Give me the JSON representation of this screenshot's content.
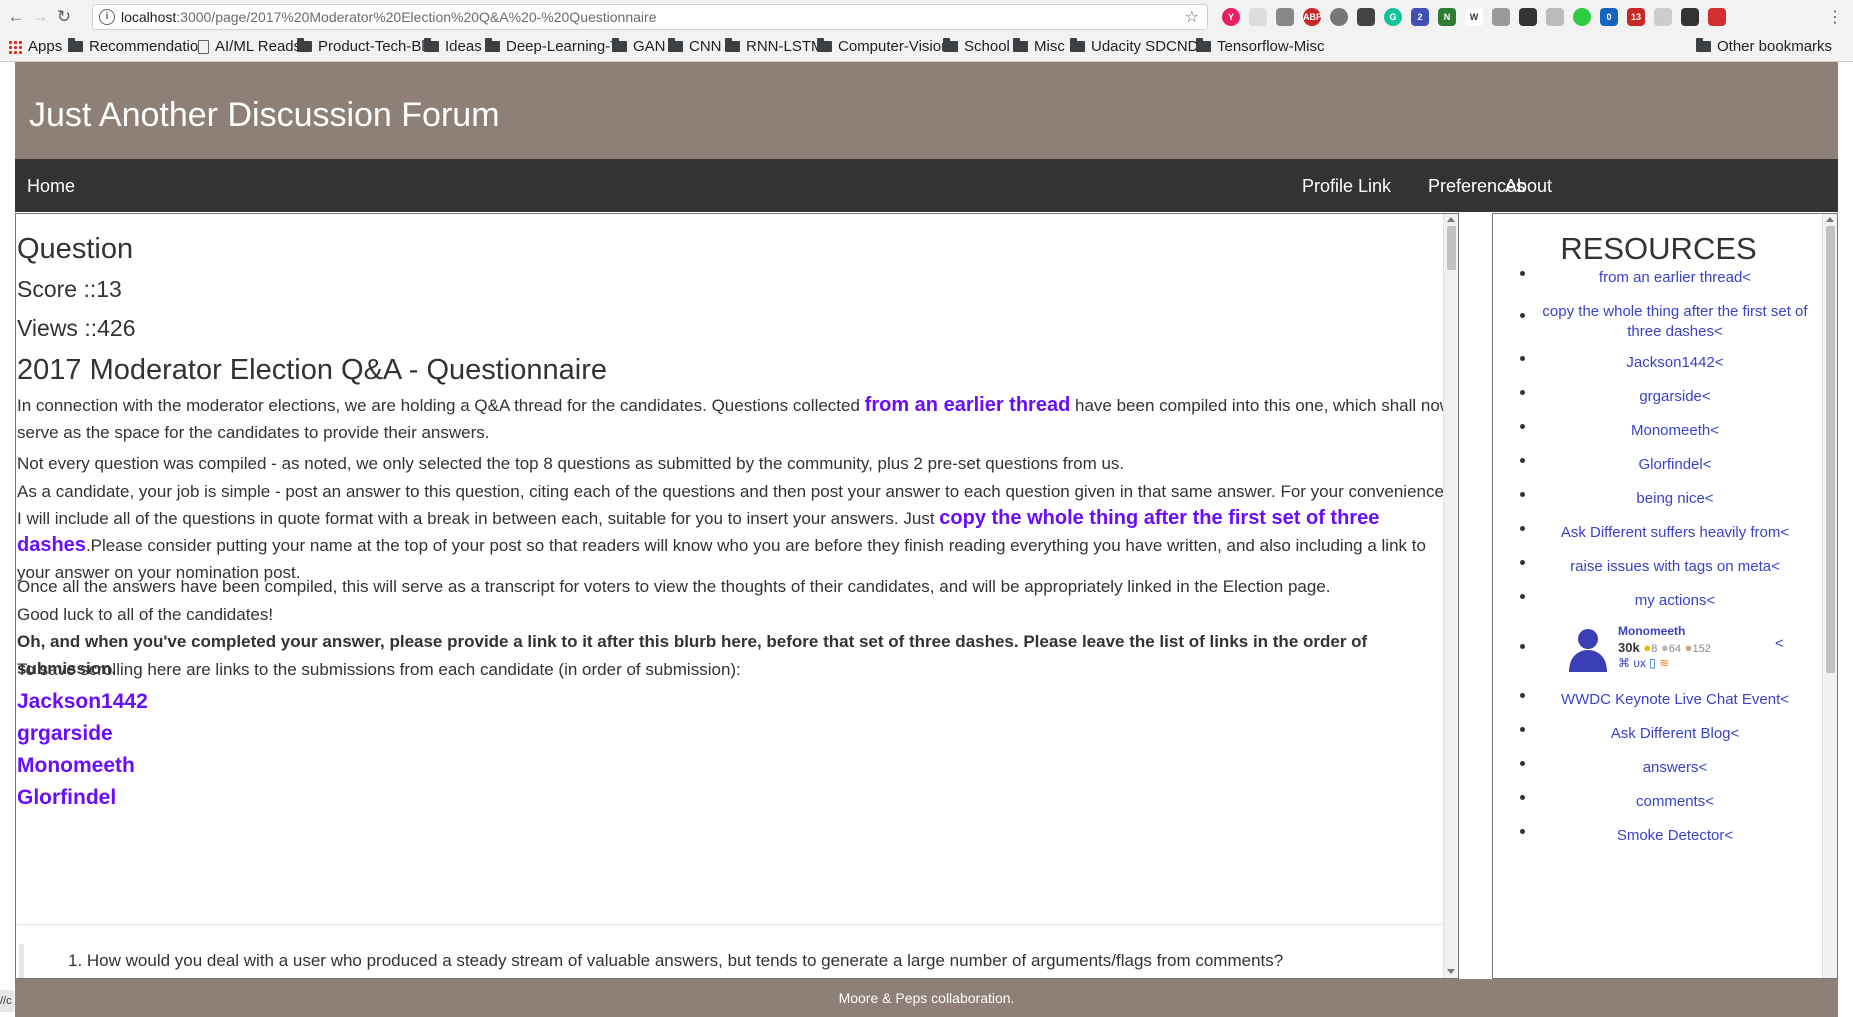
{
  "browser": {
    "url_host": "localhost",
    "url_path": ":3000/page/2017%20Moderator%20Election%20Q&A%20-%20Questionnaire",
    "bookmarks": [
      "Apps",
      "Recommendatio",
      "AI/ML Reads",
      "Product-Tech-Bl",
      "Ideas",
      "Deep-Learning-T",
      "GAN",
      "CNN",
      "RNN-LSTM",
      "Computer-Visior",
      "School",
      "Misc",
      "Udacity SDCNDP",
      "Tensorflow-Misc",
      "Other bookmarks"
    ],
    "ext_badges": {
      "two": "2",
      "zero": "0",
      "thirteen": "13"
    }
  },
  "site": {
    "title": "Just Another Discussion Forum",
    "nav": {
      "home": "Home",
      "profile": "Profile Link",
      "preferences": "Preferences",
      "about": "About"
    },
    "footer": "Moore & Peps collaboration."
  },
  "question": {
    "heading": "Question",
    "score": "Score ::13",
    "views": "Views ::426",
    "title": "2017 Moderator Election Q&A - Questionnaire",
    "p1_before": "In connection with the moderator elections, we are holding a Q&A thread for the candidates. Questions collected ",
    "p1_link": "from an earlier thread",
    "p1_after": " have been compiled into this one, which shall now serve as the space for the candidates to provide their answers.",
    "p2": "Not every question was compiled - as noted, we only selected the top 8 questions as submitted by the community, plus 2 pre-set questions from us.",
    "p3_before": "As a candidate, your job is simple - post an answer to this question, citing each of the questions and then post your answer to each question given in that same answer. For your convenience, I will include all of the questions in quote format with a break in between each, suitable for you to insert your answers. Just ",
    "p3_link": "copy the whole thing after the first set of three dashes",
    "p3_after": ".Please consider putting your name at the top of your post so that readers will know who you are before they finish reading everything you have written, and also including a link to your answer on your nomination post.",
    "p4": "Once all the answers have been compiled, this will serve as a transcript for voters to view the thoughts of their candidates, and will be appropriately linked in the Election page.",
    "p5": "Good luck to all of the candidates!",
    "p6": "Oh, and when you've completed your answer, please provide a link to it after this blurb here, before that set of three dashes. Please leave the list of links in the order of submission.",
    "p7": "To save scrolling here are links to the submissions from each candidate (in order of submission):",
    "candidates": [
      "Jackson1442",
      "grgarside",
      "Monomeeth",
      "Glorfindel"
    ],
    "quote_q1": "1. How would you deal with a user who produced a steady stream of valuable answers, but tends to generate a large number of arguments/flags from comments?"
  },
  "resources": {
    "heading": "RESOURCES",
    "items": [
      "from an earlier thread<",
      "copy the whole thing after the first set of three dashes<",
      "Jackson1442<",
      "grgarside<",
      "Monomeeth<",
      "Glorfindel<",
      "being nice<",
      "Ask Different suffers heavily from<",
      "raise issues with tags on meta<",
      "my actions<"
    ],
    "flair": {
      "name": "Monomeeth",
      "rep": "30k",
      "gold": "8",
      "silver": "64",
      "bronze": "152",
      "tags": "⌘ ᴜx",
      "trail": "<"
    },
    "items2": [
      "WWDC Keynote Live Chat Event<",
      "Ask Different Blog<",
      "answers<",
      "comments<",
      "Smoke Detector<"
    ]
  }
}
